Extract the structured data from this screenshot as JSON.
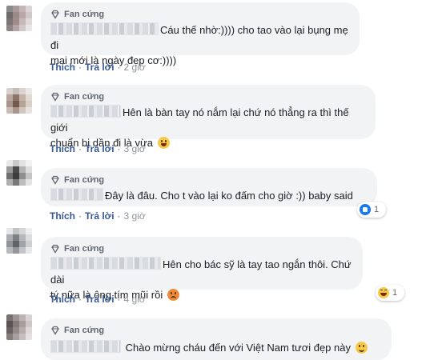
{
  "labels": {
    "badge": "Fan cứng",
    "like": "Thích",
    "reply": "Trả lời",
    "separator": "·"
  },
  "comments": [
    {
      "text_line1": "Cáu thế nhờ:)))) cho tao vào lại bụng mẹ đi",
      "text_line2": "mai mới là ngày đẹp cơ:))))",
      "time": "2 giờ"
    },
    {
      "text_line1": "Hên là bàn tay nó nắm lại chứ nó thẳng ra thì thế giới",
      "text_line2": "chuẩn bị dần đi là vừa",
      "emoji": "laughing-emoji",
      "time": "3 giờ"
    },
    {
      "text_line1": "Đây là đâu. Cho t vào lại ko đấm cho giờ :)) baby said",
      "time": "3 giờ",
      "reaction": {
        "icon": "like-icon",
        "count": "1"
      }
    },
    {
      "text_line1": "Hên cho bác sỹ là tay tao ngắn thôi. Chứ dài",
      "text_line2": "tý nữa là ông tím mũi rồi",
      "emoji": "angry-emoji",
      "time": "4 giờ",
      "reaction": {
        "icon": "haha-icon",
        "count": "1"
      }
    },
    {
      "text_line1": "Chào mừng cháu đến với Việt Nam tươi đẹp này",
      "emoji": "smiling-emoji"
    }
  ]
}
